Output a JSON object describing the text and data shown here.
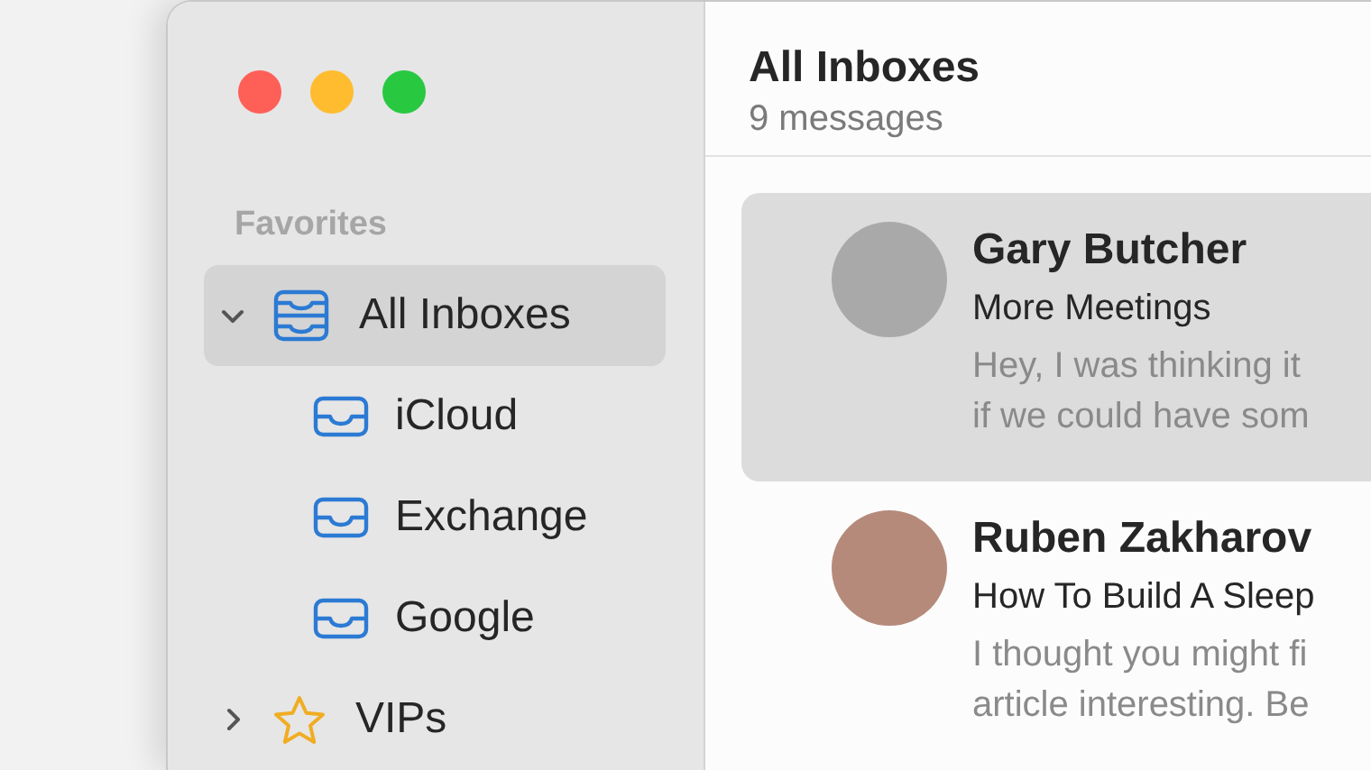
{
  "sidebar": {
    "section_title": "Favorites",
    "items": [
      {
        "kind": "inboxes",
        "label": "All Inboxes",
        "expanded": true,
        "selected": true,
        "children": [
          {
            "kind": "inbox",
            "label": "iCloud",
            "selected": false
          },
          {
            "kind": "inbox",
            "label": "Exchange",
            "selected": false
          },
          {
            "kind": "inbox",
            "label": "Google",
            "selected": false
          }
        ]
      },
      {
        "kind": "vips",
        "label": "VIPs",
        "expanded": false,
        "selected": false
      }
    ]
  },
  "message_list": {
    "title": "All Inboxes",
    "count": "9 messages",
    "messages": [
      {
        "sender": "Gary Butcher",
        "subject": "More Meetings",
        "preview": [
          "Hey, I was thinking it",
          "if we could have som"
        ],
        "selected": true
      },
      {
        "sender": "Ruben Zakharov",
        "subject": "How To Build A Sleep",
        "preview": [
          "I thought you might fi",
          "article interesting. Be"
        ],
        "selected": false
      }
    ]
  }
}
